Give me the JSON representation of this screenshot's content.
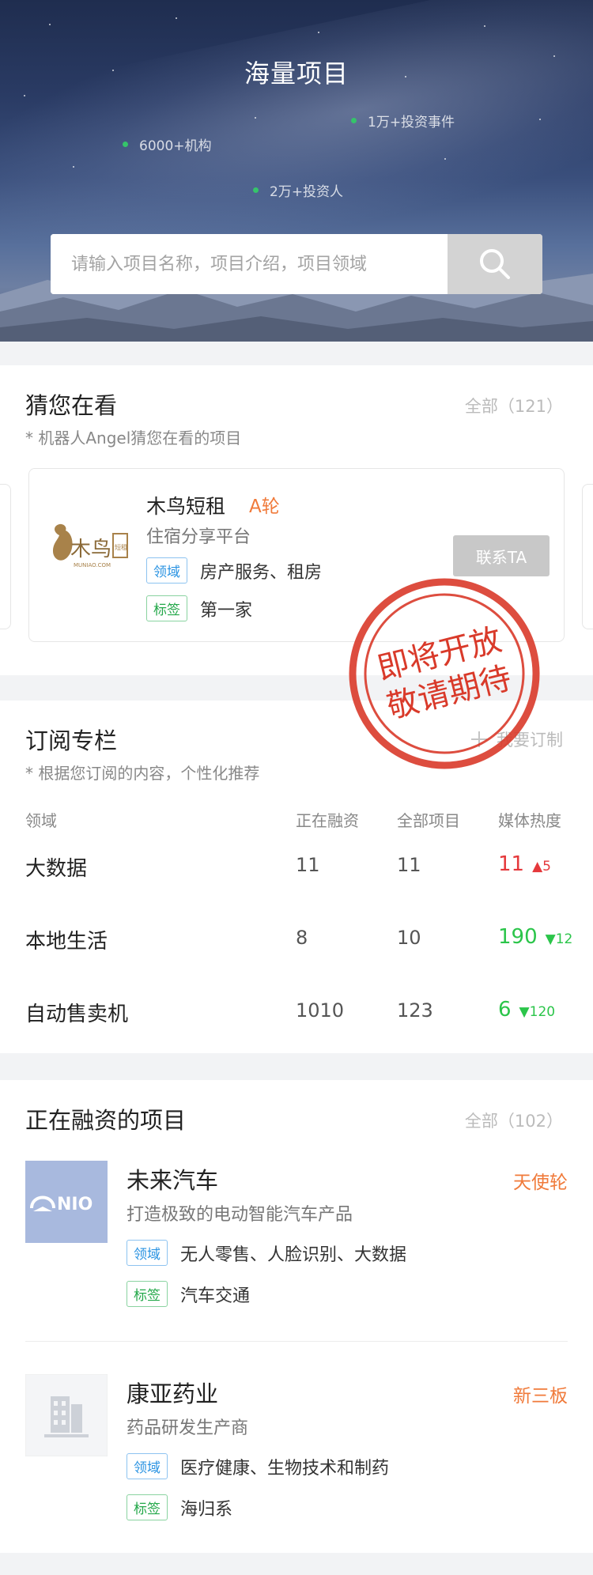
{
  "hero": {
    "title": "海量项目",
    "stats": [
      "1万+投资事件",
      "6000+机构",
      "2万+投资人"
    ],
    "search_placeholder": "请输入项目名称，项目介绍，项目领域"
  },
  "guess": {
    "title": "猜您在看",
    "subtitle": "* 机器人Angel猜您在看的项目",
    "all_label": "全部（121）",
    "card": {
      "name": "木鸟短租",
      "round": "A轮",
      "desc": "住宿分享平台",
      "field_tag": "领域",
      "field_value": "房产服务、租房",
      "label_tag": "标签",
      "label_value": "第一家",
      "contact_label": "联系TA",
      "logo_text": "木鸟",
      "logo_sub": "MUNIAO.COM",
      "logo_box_text": "短租"
    },
    "stamp": {
      "line1": "即将开放",
      "line2": "敬请期待",
      "color": "#d93a2a"
    }
  },
  "subscribe": {
    "title": "订阅专栏",
    "subtitle": "* 根据您订阅的内容，个性化推荐",
    "custom_label": "我要订制",
    "headers": [
      "领域",
      "正在融资",
      "全部项目",
      "媒体热度"
    ],
    "rows": [
      {
        "field": "大数据",
        "financing": "11",
        "total": "11",
        "heat": "11",
        "delta": "5",
        "dir": "up"
      },
      {
        "field": "本地生活",
        "financing": "8",
        "total": "10",
        "heat": "190",
        "delta": "12",
        "dir": "down"
      },
      {
        "field": "自动售卖机",
        "financing": "1010",
        "total": "123",
        "heat": "6",
        "delta": "120",
        "dir": "down"
      }
    ],
    "colors": {
      "up": "#e5383b",
      "down": "#2bc54a"
    }
  },
  "financing": {
    "title": "正在融资的项目",
    "all_label": "全部（102）",
    "projects": [
      {
        "name": "未来汽车",
        "round": "天使轮",
        "desc": "打造极致的电动智能汽车产品",
        "field_tag": "领域",
        "field_value": "无人零售、人脸识别、大数据",
        "label_tag": "标签",
        "label_value": "汽车交通",
        "logo_text": "NIO"
      },
      {
        "name": "康亚药业",
        "round": "新三板",
        "desc": "药品研发生产商",
        "field_tag": "领域",
        "field_value": "医疗健康、生物技术和制药",
        "label_tag": "标签",
        "label_value": "海归系"
      }
    ]
  }
}
